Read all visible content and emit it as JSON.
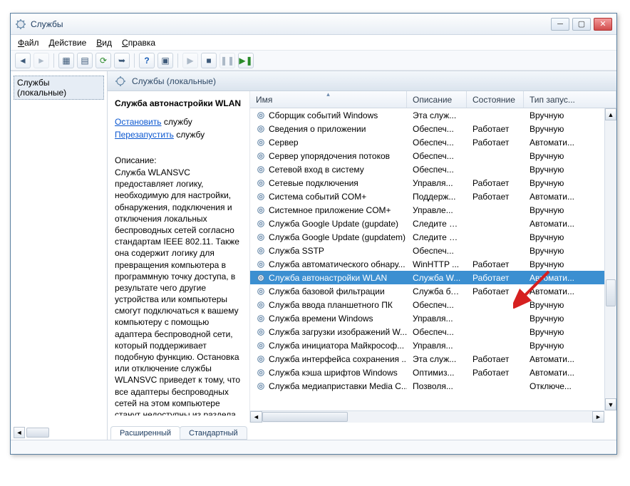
{
  "window": {
    "title": "Службы"
  },
  "menu": {
    "file": "Файл",
    "action": "Действие",
    "view": "Вид",
    "help": "Справка"
  },
  "tree": {
    "root": "Службы (локальные)"
  },
  "header": {
    "title": "Службы (локальные)"
  },
  "detail": {
    "name": "Служба автонастройки WLAN",
    "stop_link": "Остановить",
    "stop_suffix": " службу",
    "restart_link": "Перезапустить",
    "restart_suffix": " службу",
    "desc_label": "Описание:",
    "desc_body": "Служба WLANSVC предоставляет логику, необходимую для настройки, обнаружения, подключения и отключения локальных беспроводных сетей согласно стандартам IEEE 802.11. Также она содержит логику для превращения компьютера в программную точку доступа, в результате чего другие устройства или компьютеры смогут подключаться к вашему компьютеру с помощью адаптера беспроводной сети, который поддерживает подобную функцию. Остановка или отключение службы WLANSVC приведет к тому, что все адаптеры беспроводных сетей на этом компьютере станут недоступны из раздела"
  },
  "cols": {
    "name": "Имя",
    "desc": "Описание",
    "state": "Состояние",
    "start": "Тип запус..."
  },
  "svcs": [
    {
      "n": "Сборщик событий Windows",
      "d": "Эта служ...",
      "s": "",
      "t": "Вручную"
    },
    {
      "n": "Сведения о приложении",
      "d": "Обеспеч...",
      "s": "Работает",
      "t": "Вручную"
    },
    {
      "n": "Сервер",
      "d": "Обеспеч...",
      "s": "Работает",
      "t": "Автомати..."
    },
    {
      "n": "Сервер упорядочения потоков",
      "d": "Обеспеч...",
      "s": "",
      "t": "Вручную"
    },
    {
      "n": "Сетевой вход в систему",
      "d": "Обеспеч...",
      "s": "",
      "t": "Вручную"
    },
    {
      "n": "Сетевые подключения",
      "d": "Управля...",
      "s": "Работает",
      "t": "Вручную"
    },
    {
      "n": "Система событий COM+",
      "d": "Поддерж...",
      "s": "Работает",
      "t": "Автомати..."
    },
    {
      "n": "Системное приложение COM+",
      "d": "Управле...",
      "s": "",
      "t": "Вручную"
    },
    {
      "n": "Служба Google Update (gupdate)",
      "d": "Следите за...",
      "s": "",
      "t": "Автомати..."
    },
    {
      "n": "Служба Google Update (gupdatem)",
      "d": "Следите за...",
      "s": "",
      "t": "Вручную"
    },
    {
      "n": "Служба SSTP",
      "d": "Обеспеч...",
      "s": "",
      "t": "Вручную"
    },
    {
      "n": "Служба автоматического обнару...",
      "d": "WinHTTP ...",
      "s": "Работает",
      "t": "Вручную"
    },
    {
      "n": "Служба автонастройки WLAN",
      "d": "Служба W...",
      "s": "Работает",
      "t": "Автомати...",
      "sel": true
    },
    {
      "n": "Служба базовой фильтрации",
      "d": "Служба ба...",
      "s": "Работает",
      "t": "Автомати..."
    },
    {
      "n": "Служба ввода планшетного ПК",
      "d": "Обеспеч...",
      "s": "",
      "t": "Вручную"
    },
    {
      "n": "Служба времени Windows",
      "d": "Управля...",
      "s": "",
      "t": "Вручную"
    },
    {
      "n": "Служба загрузки изображений W...",
      "d": "Обеспеч...",
      "s": "",
      "t": "Вручную"
    },
    {
      "n": "Служба инициатора Майкрософ...",
      "d": "Управля...",
      "s": "",
      "t": "Вручную"
    },
    {
      "n": "Служба интерфейса сохранения ...",
      "d": "Эта служ...",
      "s": "Работает",
      "t": "Автомати..."
    },
    {
      "n": "Служба кэша шрифтов Windows",
      "d": "Оптимиз...",
      "s": "Работает",
      "t": "Автомати..."
    },
    {
      "n": "Служба медиаприставки Media C...",
      "d": "Позволя...",
      "s": "",
      "t": "Отключе..."
    }
  ],
  "tabs": {
    "ext": "Расширенный",
    "std": "Стандартный"
  }
}
